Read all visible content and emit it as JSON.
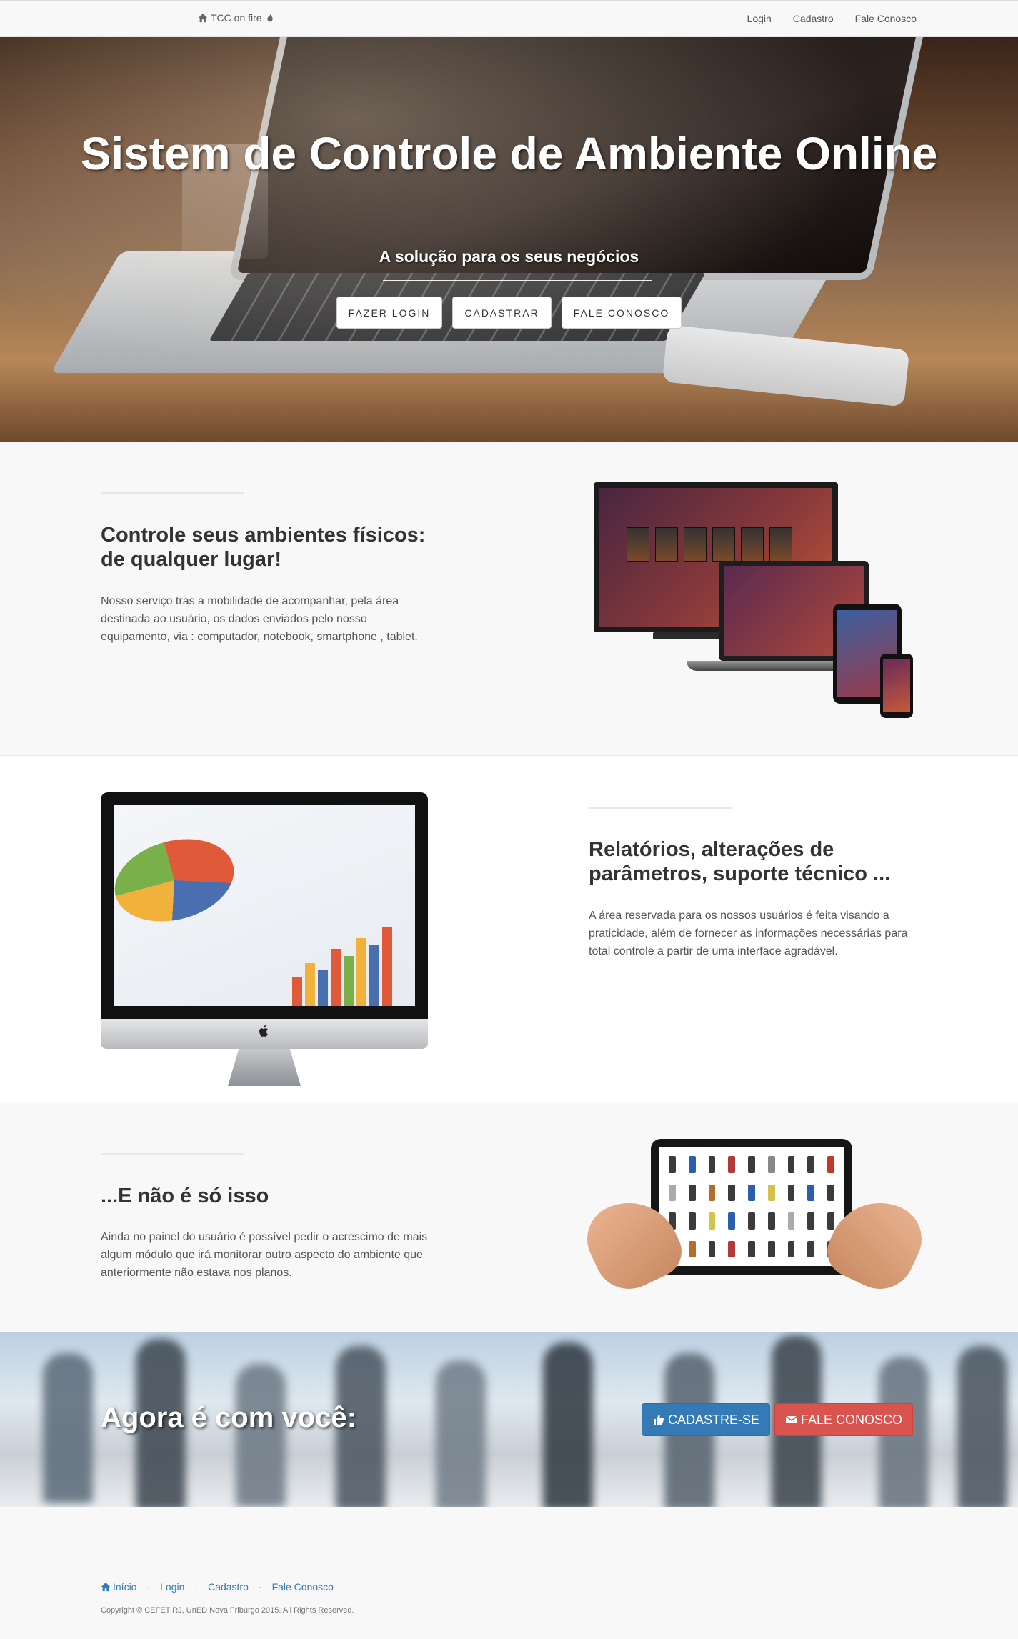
{
  "navbar": {
    "brand": "TCC on fire",
    "links": [
      "Login",
      "Cadastro",
      "Fale Conosco"
    ]
  },
  "hero": {
    "title": "Sistem de Controle de Ambiente Online",
    "subtitle": "A solução para os seus negócios",
    "buttons": [
      "FAZER LOGIN",
      "CADASTRAR",
      "FALE CONOSCO"
    ]
  },
  "sections": [
    {
      "heading": "Controle seus ambientes físicos: de qualquer lugar!",
      "text": "Nosso serviço tras a mobilidade de acompanhar, pela área destinada ao usuário, os dados enviados pelo nosso equipamento, via : computador, notebook, smartphone , tablet."
    },
    {
      "heading": "Relatórios, alterações de parâmetros, suporte técnico ...",
      "text": "A área reservada para os nossos usuários é feita visando a praticidade, além de fornecer as informações necessárias para total controle a partir de uma interface agradável."
    },
    {
      "heading": "...E não é só isso",
      "text": "Ainda no painel do usuário é possível pedir o acrescimo de mais algum módulo que irá monitorar outro aspecto do ambiente que anteriormente não estava nos planos."
    }
  ],
  "cta": {
    "text": "Agora é com você:",
    "signup": "CADASTRE-SE",
    "contact": "FALE CONOSCO"
  },
  "footer": {
    "links": [
      "Início",
      "Login",
      "Cadastro",
      "Fale Conosco"
    ],
    "copyright": "Copyright © CEFET RJ, UnED Nova Friburgo 2015. All Rights Reserved."
  },
  "colors": {
    "primary": "#337ab7",
    "danger": "#d9534f",
    "navbar_bg": "#f8f8f8"
  }
}
